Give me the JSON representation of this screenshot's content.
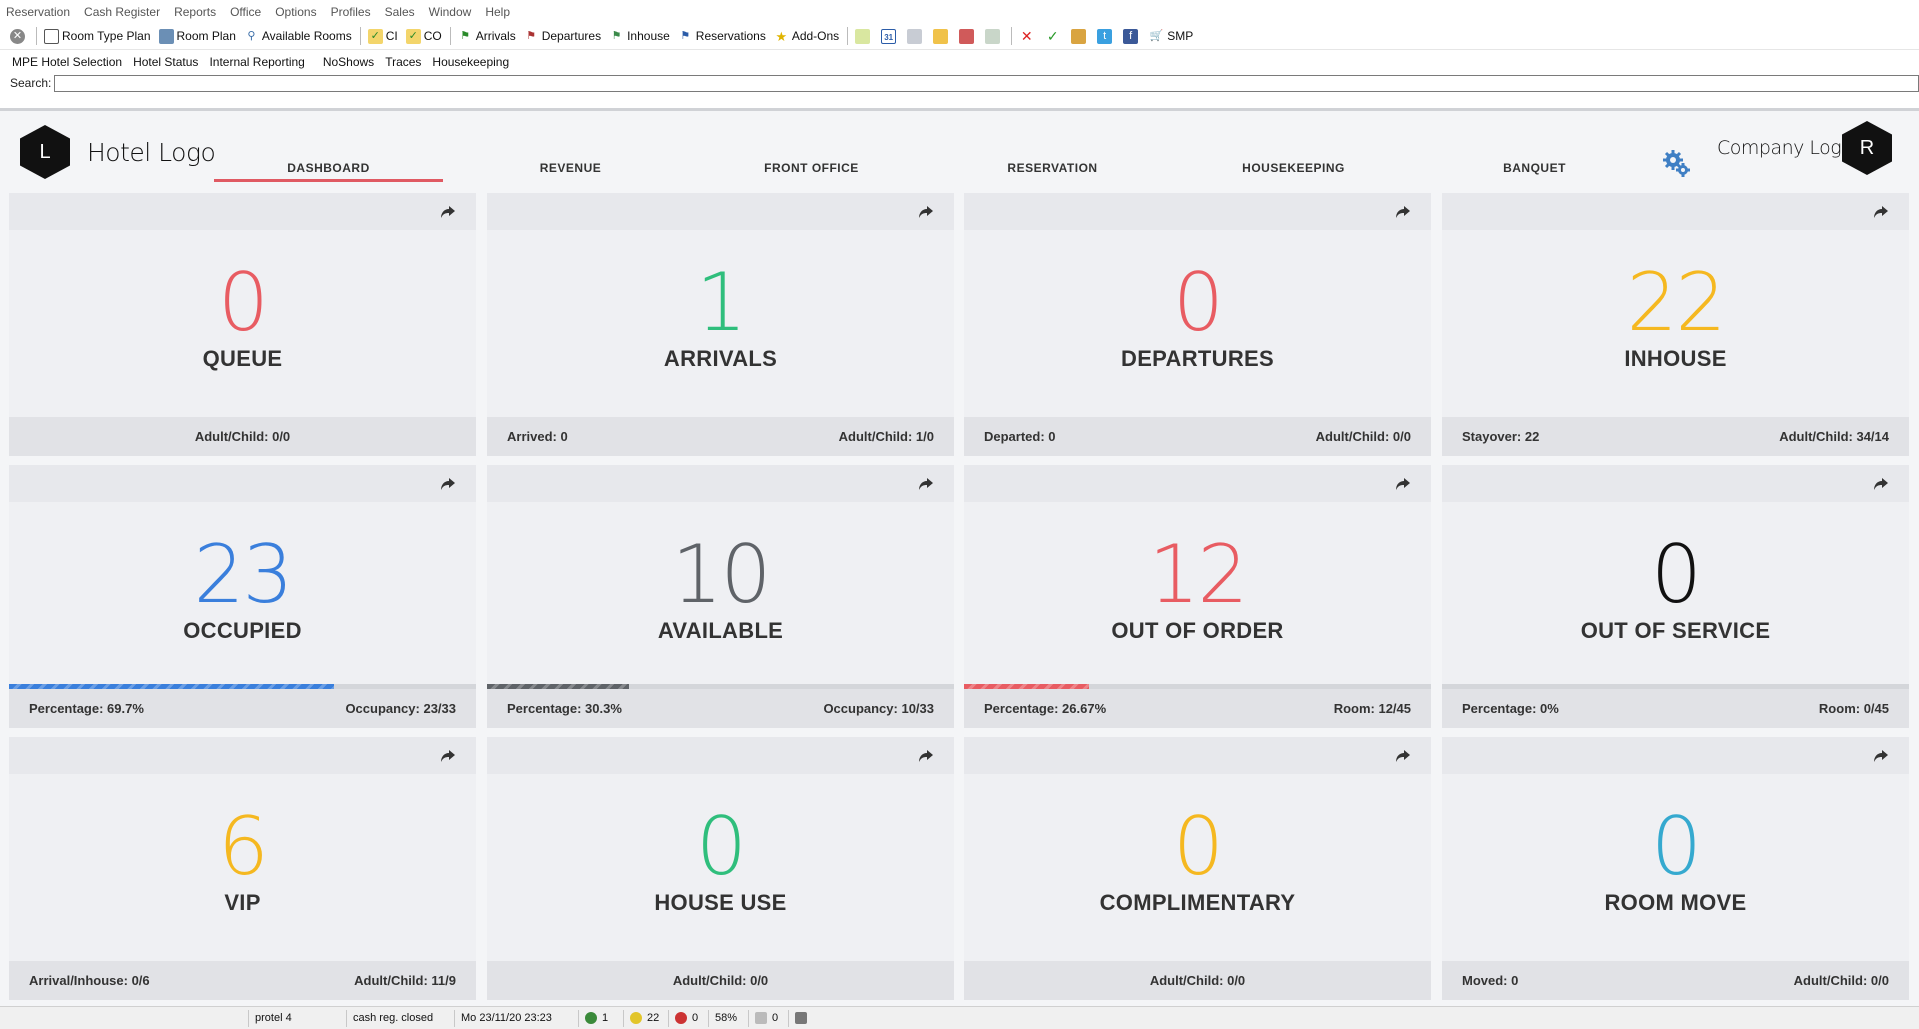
{
  "menu": [
    "Reservation",
    "Cash Register",
    "Reports",
    "Office",
    "Options",
    "Profiles",
    "Sales",
    "Window",
    "Help"
  ],
  "toolbar": {
    "room_type_plan": "Room Type Plan",
    "room_plan": "Room Plan",
    "available_rooms": "Available Rooms",
    "ci": "CI",
    "co": "CO",
    "arrivals": "Arrivals",
    "departures": "Departures",
    "inhouse": "Inhouse",
    "reservations": "Reservations",
    "add_ons": "Add-Ons",
    "calendar_day": "31",
    "smp": "SMP"
  },
  "subnav": [
    "MPE Hotel Selection",
    "Hotel Status",
    "Internal Reporting",
    "NoShows",
    "Traces",
    "Housekeeping"
  ],
  "search": {
    "label": "Search:",
    "value": ""
  },
  "header": {
    "hotel_logo_letter": "L",
    "hotel_logo_text": "Hotel Logo",
    "company_logo_text": "Company Logo",
    "company_logo_letter": "R",
    "tabs": [
      "DASHBOARD",
      "REVENUE",
      "FRONT OFFICE",
      "RESERVATION",
      "HOUSEKEEPING",
      "BANQUET"
    ],
    "active_tab": "DASHBOARD",
    "accent_color": "#e05a63"
  },
  "cards": [
    {
      "value": "0",
      "label": "QUEUE",
      "color": "#e85c62",
      "footer_left": "",
      "footer_right": "Adult/Child: 0/0"
    },
    {
      "value": "1",
      "label": "ARRIVALS",
      "color": "#2fbe7c",
      "footer_left": "Arrived: 0",
      "footer_right": "Adult/Child: 1/0"
    },
    {
      "value": "0",
      "label": "DEPARTURES",
      "color": "#e85c62",
      "footer_left": "Departed: 0",
      "footer_right": "Adult/Child: 0/0"
    },
    {
      "value": "22",
      "label": "INHOUSE",
      "color": "#f5b820",
      "footer_left": "Stayover: 22",
      "footer_right": "Adult/Child: 34/14"
    },
    {
      "value": "23",
      "label": "OCCUPIED",
      "color": "#3a7fdc",
      "footer_left": "Percentage: 69.7%",
      "footer_right": "Occupancy: 23/33",
      "progress": 0.697,
      "progress_color": "#3a7fdc"
    },
    {
      "value": "10",
      "label": "AVAILABLE",
      "color": "#5f6368",
      "footer_left": "Percentage: 30.3%",
      "footer_right": "Occupancy: 10/33",
      "progress": 0.303,
      "progress_color": "#5f6368"
    },
    {
      "value": "12",
      "label": "OUT OF ORDER",
      "color": "#e85c62",
      "footer_left": "Percentage: 26.67%",
      "footer_right": "Room: 12/45",
      "progress": 0.2667,
      "progress_color": "#e85c62"
    },
    {
      "value": "0",
      "label": "OUT OF SERVICE",
      "color": "#111111",
      "footer_left": "Percentage: 0%",
      "footer_right": "Room: 0/45",
      "progress": 0,
      "progress_color": "#111111"
    },
    {
      "value": "6",
      "label": "VIP",
      "color": "#f5b820",
      "footer_left": "Arrival/Inhouse: 0/6",
      "footer_right": "Adult/Child: 11/9"
    },
    {
      "value": "0",
      "label": "HOUSE USE",
      "color": "#2fbe7c",
      "footer_left": "",
      "footer_right": "Adult/Child: 0/0"
    },
    {
      "value": "0",
      "label": "COMPLIMENTARY",
      "color": "#f5b820",
      "footer_left": "",
      "footer_right": "Adult/Child: 0/0"
    },
    {
      "value": "0",
      "label": "ROOM MOVE",
      "color": "#35a9cf",
      "footer_left": "Moved: 0",
      "footer_right": "Adult/Child: 0/0"
    }
  ],
  "status": {
    "system": "protel 4",
    "cash": "cash reg. closed",
    "datetime": "Mo 23/11/20 23:23",
    "count1": "1",
    "count2": "22",
    "count3": "0",
    "percent": "58%",
    "count4": "0"
  }
}
